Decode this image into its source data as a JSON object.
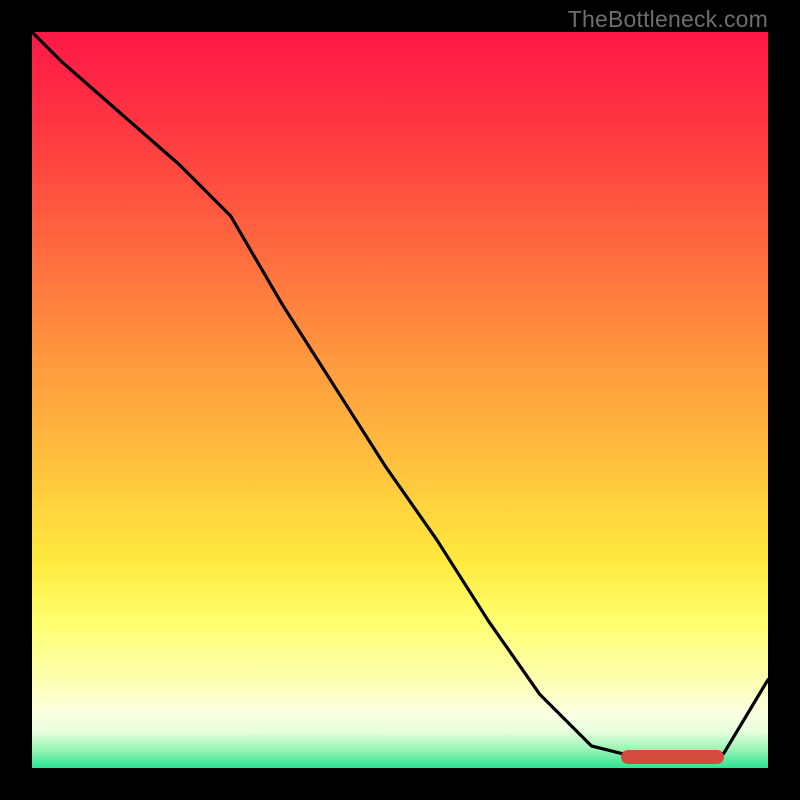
{
  "watermark": "TheBottleneck.com",
  "colors": {
    "frame_bg": "#000000",
    "curve_stroke": "#000000",
    "marker": "#d44a3d",
    "watermark_text": "#6e6e6e"
  },
  "chart_data": {
    "type": "line",
    "title": "",
    "xlabel": "",
    "ylabel": "",
    "xlim": [
      0,
      100
    ],
    "ylim": [
      0,
      100
    ],
    "grid": false,
    "legend": false,
    "series": [
      {
        "name": "curve",
        "x": [
          0,
          4,
          12,
          20,
          27,
          34,
          41,
          48,
          55,
          62,
          69,
          76,
          80,
          85,
          88,
          91,
          94,
          100
        ],
        "y": [
          100,
          96,
          89,
          82,
          75,
          63,
          52,
          41,
          31,
          20,
          10,
          3,
          2,
          1,
          1,
          1,
          2,
          12
        ]
      }
    ],
    "annotations": [
      {
        "kind": "highlight-band",
        "x0": 80,
        "x1": 94,
        "y": 1
      }
    ]
  }
}
